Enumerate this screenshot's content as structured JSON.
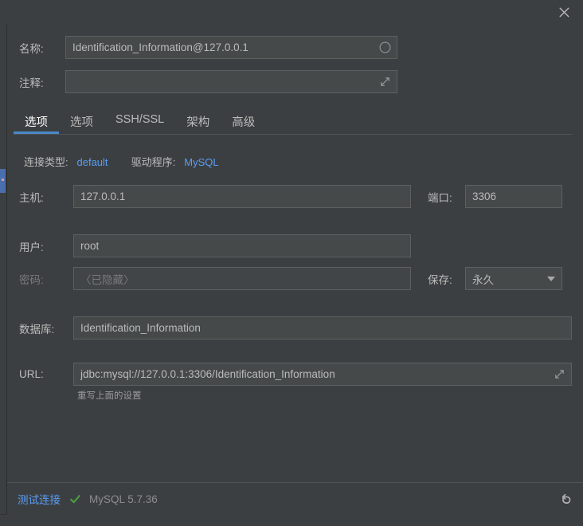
{
  "window": {
    "close_icon": "close-icon"
  },
  "top_form": {
    "name": {
      "label": "名称:",
      "value": "Identification_Information@127.0.0.1",
      "icon": "circle-indicator-icon"
    },
    "comment": {
      "label": "注释:",
      "value": "",
      "placeholder": "",
      "icon": "expand-icon"
    }
  },
  "tabs": [
    {
      "label": "选项",
      "active": true
    },
    {
      "label": "选项",
      "active": false
    },
    {
      "label": "SSH/SSL",
      "active": false
    },
    {
      "label": "架构",
      "active": false
    },
    {
      "label": "高级",
      "active": false
    }
  ],
  "meta": {
    "connection_type_label": "连接类型:",
    "connection_type_value": "default",
    "driver_label": "驱动程序:",
    "driver_value": "MySQL"
  },
  "fields": {
    "host": {
      "label": "主机:",
      "value": "127.0.0.1"
    },
    "port": {
      "label": "端口:",
      "value": "3306"
    },
    "user": {
      "label": "用户:",
      "value": "root"
    },
    "password": {
      "label": "密码:",
      "value": "",
      "placeholder": "〈已隐藏〉"
    },
    "save": {
      "label": "保存:",
      "value": "永久",
      "caret_icon": "chevron-down-icon"
    },
    "database": {
      "label": "数据库:",
      "value": "Identification_Information"
    },
    "url": {
      "label": "URL:",
      "value": "jdbc:mysql://127.0.0.1:3306/Identification_Information",
      "icon": "expand-icon",
      "hint": "重写上面的设置"
    }
  },
  "footer": {
    "test_connection_label": "测试连接",
    "status_icon": "check-success-icon",
    "db_version": "MySQL 5.7.36",
    "revert_icon": "revert-icon"
  },
  "colors": {
    "accent_blue": "#4a88c7",
    "link_blue": "#589df6",
    "success_green": "#4c9b41",
    "panel_bg": "#3c3f41",
    "field_bg": "#45494a",
    "field_border": "#5e6060"
  }
}
